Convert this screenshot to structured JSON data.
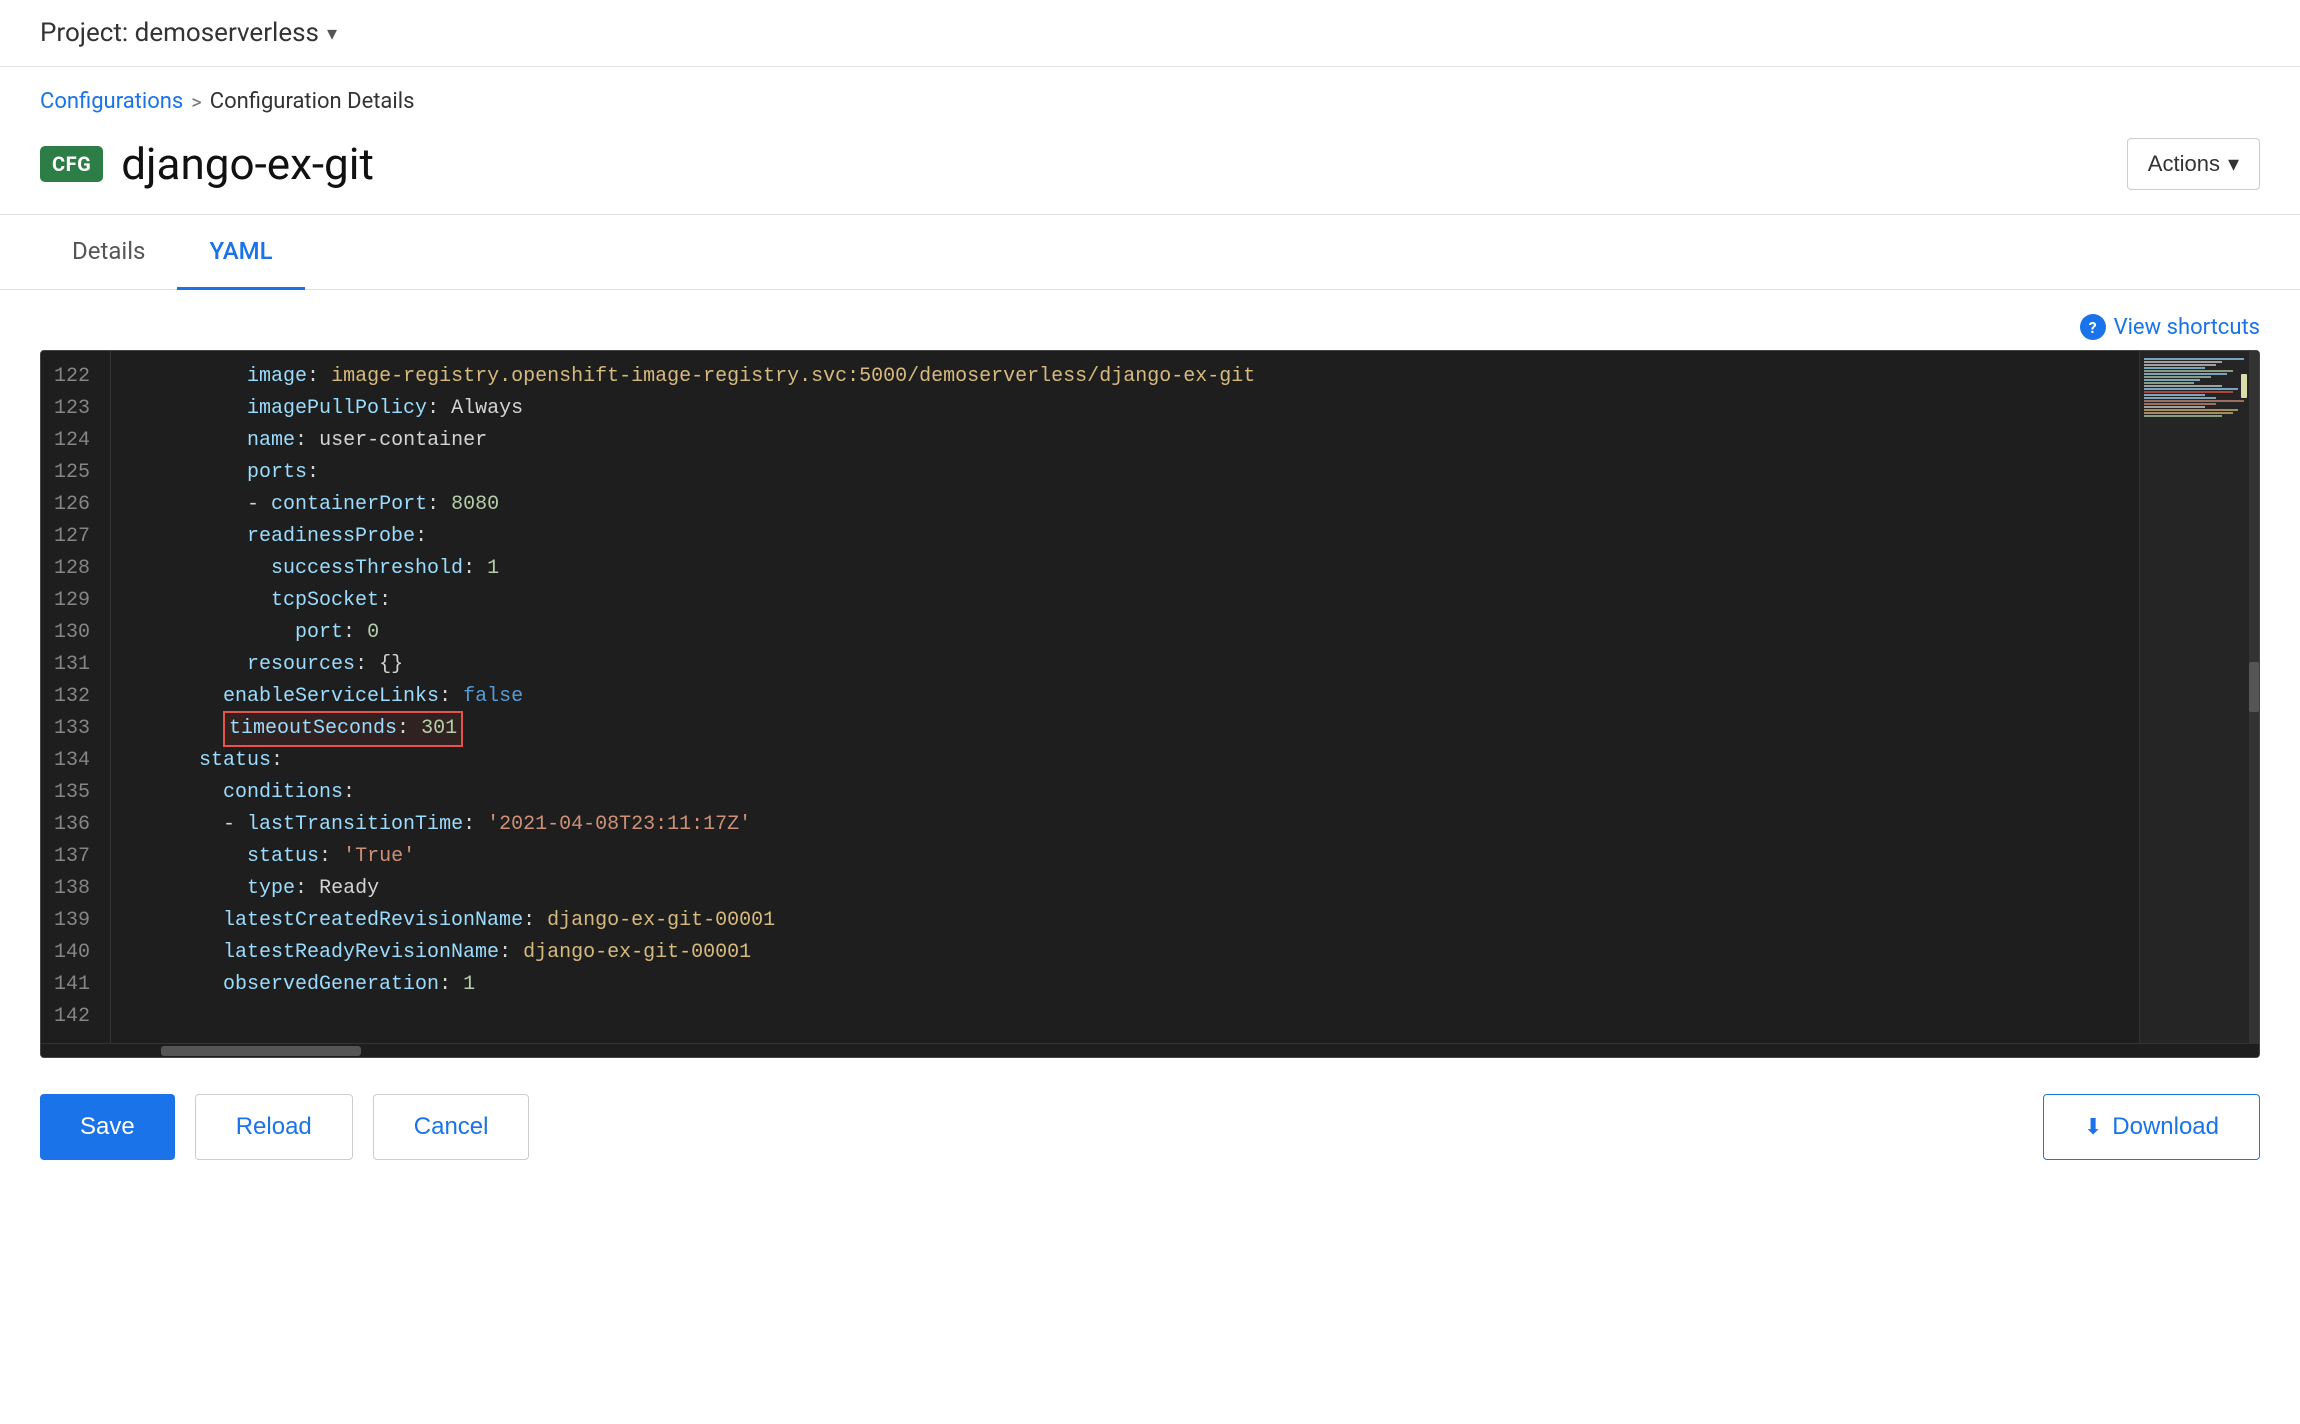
{
  "topbar": {
    "project_label": "Project: demoserverless"
  },
  "breadcrumb": {
    "parent": "Configurations",
    "separator": ">",
    "current": "Configuration Details"
  },
  "header": {
    "badge": "CFG",
    "title": "django-ex-git",
    "actions_label": "Actions"
  },
  "tabs": [
    {
      "id": "details",
      "label": "Details",
      "active": false
    },
    {
      "id": "yaml",
      "label": "YAML",
      "active": true
    }
  ],
  "shortcuts": {
    "label": "View shortcuts"
  },
  "code": {
    "lines": [
      {
        "num": 122,
        "content": "          image: image-registry.openshift-image-registry.svc:5000/demoserverless/django-ex-git",
        "type": "image"
      },
      {
        "num": 123,
        "content": "          imagePullPolicy: Always",
        "type": "normal"
      },
      {
        "num": 124,
        "content": "          name: user-container",
        "type": "normal"
      },
      {
        "num": 125,
        "content": "          ports:",
        "type": "normal"
      },
      {
        "num": 126,
        "content": "          - containerPort: 8080",
        "type": "port"
      },
      {
        "num": 127,
        "content": "          readinessProbe:",
        "type": "normal"
      },
      {
        "num": 128,
        "content": "            successThreshold: 1",
        "type": "normal"
      },
      {
        "num": 129,
        "content": "            tcpSocket:",
        "type": "normal"
      },
      {
        "num": 130,
        "content": "              port: 0",
        "type": "normal"
      },
      {
        "num": 131,
        "content": "          resources: {}",
        "type": "normal"
      },
      {
        "num": 132,
        "content": "        enableServiceLinks: false",
        "type": "normal"
      },
      {
        "num": 133,
        "content": "        timeoutSeconds: 301",
        "type": "highlight"
      },
      {
        "num": 134,
        "content": "      status:",
        "type": "normal"
      },
      {
        "num": 135,
        "content": "        conditions:",
        "type": "normal"
      },
      {
        "num": 136,
        "content": "        - lastTransitionTime: '2021-04-08T23:11:17Z'",
        "type": "string"
      },
      {
        "num": 137,
        "content": "          status: 'True'",
        "type": "string2"
      },
      {
        "num": 138,
        "content": "          type: Ready",
        "type": "normal"
      },
      {
        "num": 139,
        "content": "        latestCreatedRevisionName: django-ex-git-00001",
        "type": "revision"
      },
      {
        "num": 140,
        "content": "        latestReadyRevisionName: django-ex-git-00001",
        "type": "revision2"
      },
      {
        "num": 141,
        "content": "        observedGeneration: 1",
        "type": "normal"
      },
      {
        "num": 142,
        "content": "",
        "type": "empty"
      }
    ]
  },
  "buttons": {
    "save": "Save",
    "reload": "Reload",
    "cancel": "Cancel",
    "download": "Download"
  }
}
